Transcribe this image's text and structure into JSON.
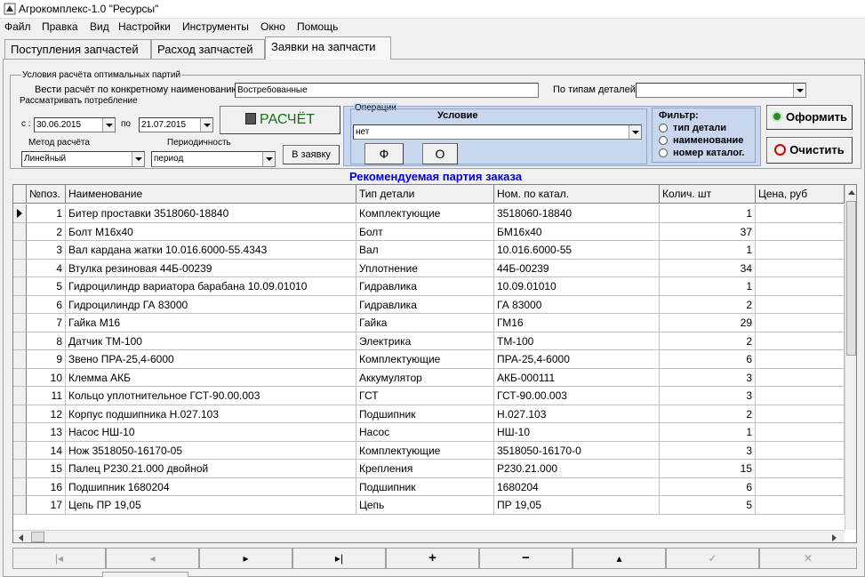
{
  "window": {
    "title": "Агрокомплекс-1.0 \"Ресурсы\""
  },
  "menu": [
    "Файл",
    "Правка",
    "Вид",
    "Настройки",
    "Инструменты",
    "Окно",
    "Помощь"
  ],
  "tabs": [
    "Поступления запчастей",
    "Расход запчастей",
    "Заявки на запчасти"
  ],
  "conditions": {
    "group_title": "Условия расчёта оптимальных партий",
    "by_name_label": "Вести расчёт по конкретному наименованию",
    "by_name_value": "Востребованные",
    "by_type_label": "По типам деталей",
    "by_type_value": "",
    "consider_label": "Рассматривать потребление",
    "from_label": "с :",
    "from_date": "30.06.2015",
    "to_label": "по",
    "to_date": "21.07.2015",
    "calc_button": "РАСЧЁТ",
    "method_label": "Метод расчёта",
    "method_value": "Линейный",
    "period_label": "Периодичность",
    "period_value": "период",
    "to_order_button": "В заявку"
  },
  "operations": {
    "title": "Операции",
    "condition_label": "Условие",
    "condition_value": "нет",
    "f_button": "Ф",
    "o_button": "О",
    "filter_label": "Фильтр:",
    "filters": [
      "тип детали",
      "наименование",
      "номер каталог."
    ]
  },
  "actions": {
    "submit": "Оформить",
    "clear": "Очистить"
  },
  "grid": {
    "caption": "Рекомендуемая партия заказа",
    "columns": [
      "№поз.",
      "Наименование",
      "Тип детали",
      "Ном. по катал.",
      "Колич. шт",
      "Цена, руб"
    ],
    "rows": [
      [
        "1",
        "Битер проставки 3518060-18840",
        "Комплектующие",
        "3518060-18840",
        "1",
        ""
      ],
      [
        "2",
        "Болт М16х40",
        "Болт",
        "БМ16х40",
        "37",
        ""
      ],
      [
        "3",
        "Вал кардана жатки 10.016.6000-55.4343",
        "Вал",
        "10.016.6000-55",
        "1",
        ""
      ],
      [
        "4",
        "Втулка резиновая 44Б-00239",
        "Уплотнение",
        "44Б-00239",
        "34",
        ""
      ],
      [
        "5",
        "Гидроцилиндр вариатора барабана 10.09.01010",
        "Гидравлика",
        "10.09.01010",
        "1",
        ""
      ],
      [
        "6",
        "Гидроцилиндр ГА 83000",
        "Гидравлика",
        "ГА 83000",
        "2",
        ""
      ],
      [
        "7",
        "Гайка М16",
        "Гайка",
        "ГМ16",
        "29",
        ""
      ],
      [
        "8",
        "Датчик ТМ-100",
        "Электрика",
        "ТМ-100",
        "2",
        ""
      ],
      [
        "9",
        "Звено ПРА-25,4-6000",
        "Комплектующие",
        "ПРА-25,4-6000",
        "6",
        ""
      ],
      [
        "10",
        "Клемма АКБ",
        "Аккумулятор",
        "АКБ-000111",
        "3",
        ""
      ],
      [
        "11",
        "Кольцо уплотнительное ГСТ-90.00.003",
        "ГСТ",
        "ГСТ-90.00.003",
        "3",
        ""
      ],
      [
        "12",
        "Корпус подшипника Н.027.103",
        "Подшипник",
        "Н.027.103",
        "2",
        ""
      ],
      [
        "13",
        "Насос НШ-10",
        "Насос",
        "НШ-10",
        "1",
        ""
      ],
      [
        "14",
        "Нож 3518050-16170-05",
        "Комплектующие",
        "3518050-16170-0",
        "3",
        ""
      ],
      [
        "15",
        "Палец Р230.21.000 двойной",
        "Крепления",
        "Р230.21.000",
        "15",
        ""
      ],
      [
        "16",
        "Подшипник 1680204",
        "Подшипник",
        "1680204",
        "6",
        ""
      ],
      [
        "17",
        "Цепь ПР 19,05",
        "Цепь",
        "ПР 19,05",
        "5",
        ""
      ]
    ]
  },
  "navigator": [
    "first",
    "prior",
    "next",
    "last",
    "insert",
    "delete",
    "edit",
    "post",
    "cancel"
  ]
}
